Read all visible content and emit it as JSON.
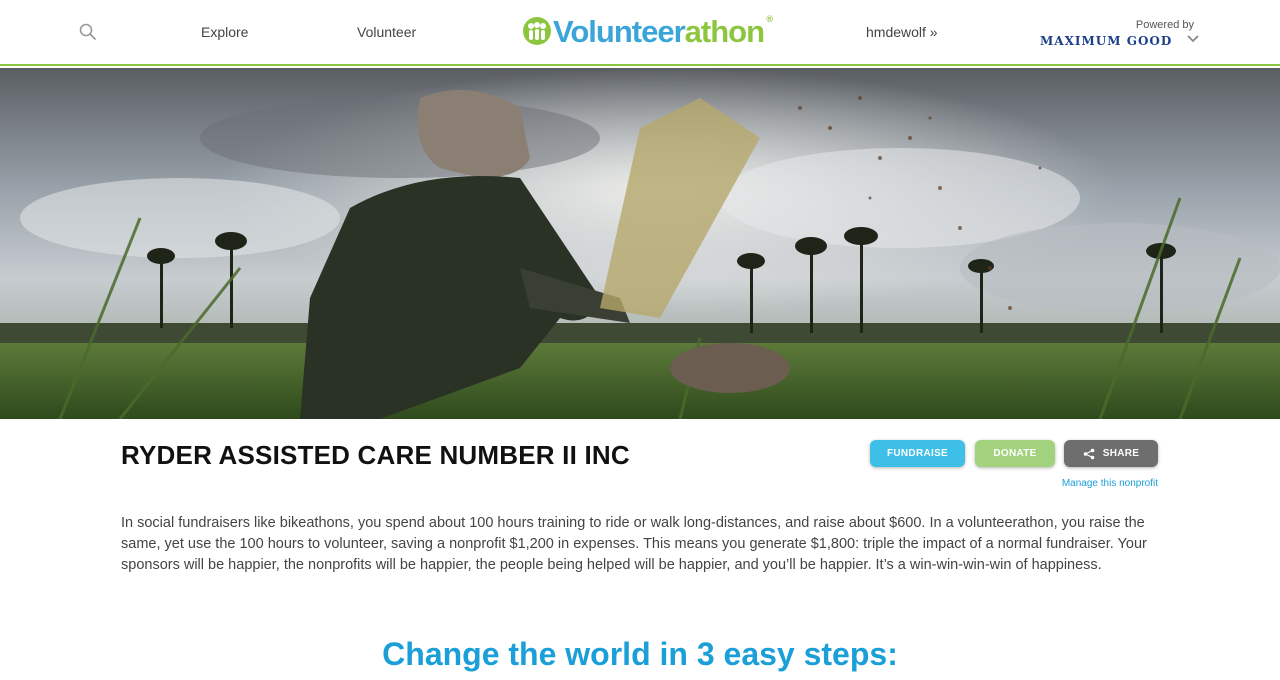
{
  "header": {
    "nav": {
      "explore": "Explore",
      "volunteer": "Volunteer",
      "user": "hmdewolf »"
    },
    "logo": {
      "part1": "Volunteer",
      "part2": "athon",
      "registered": "®"
    },
    "powered_by": {
      "label": "Powered by",
      "brand": "MAXIMUM GOOD"
    },
    "icons": [
      "search-icon",
      "chevron-down-icon"
    ]
  },
  "hero": {
    "icon": "hero-photo"
  },
  "org": {
    "title": "RYDER ASSISTED CARE NUMBER II INC"
  },
  "actions": {
    "fundraise": "FUNDRAISE",
    "donate": "DONATE",
    "share": "SHARE",
    "manage": "Manage this nonprofit"
  },
  "description": "In social fundraisers like bikeathons, you spend about 100 hours training to ride or walk long-distances, and raise about $600. In a volunteerathon, you raise the same, yet use the 100 hours to volunteer, saving a nonprofit $1,200 in expenses. This means you generate $1,800: triple the impact of a normal fundraiser. Your sponsors will be happier, the nonprofits will be happier, the people being helped will be happier, and you’ll be happier. It’s a win-win-win-win of happiness.",
  "steps_heading": "Change the world in 3 easy steps:",
  "colors": {
    "accent_blue": "#1a9fd8",
    "accent_green": "#8cc63f",
    "fundraise": "#3dbfe8",
    "donate": "#a3d27f",
    "share": "#6e6e6e"
  }
}
